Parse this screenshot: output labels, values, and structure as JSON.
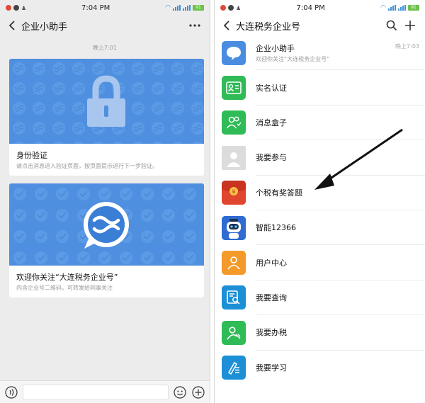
{
  "status_bar": {
    "time": "7:04 PM",
    "battery": "91"
  },
  "left": {
    "title": "企业小助手",
    "timestamp": "晚上7:01",
    "cards": [
      {
        "title": "身份验证",
        "desc": "请点击消息进入验证页面，按页面提示进行下一步验证。"
      },
      {
        "title": "欢迎你关注“大连税务企业号”",
        "desc": "内含企业号二维码，可转发给同事关注"
      }
    ]
  },
  "right": {
    "title": "大连税务企业号",
    "items": [
      {
        "label": "企业小助手",
        "sub": "欢迎你关注“大连税务企业号”",
        "time": "晚上7:03",
        "icon": "chat-bubble-icon",
        "color": "#4a8de0"
      },
      {
        "label": "实名认证",
        "icon": "id-card-icon",
        "color": "#2fbb55"
      },
      {
        "label": "消息盒子",
        "icon": "people-icon",
        "color": "#2fbb55"
      },
      {
        "label": "我要参与",
        "icon": "person-placeholder-icon",
        "color": "#dcdcdc"
      },
      {
        "label": "个税有奖答题",
        "icon": "red-envelope-icon",
        "color": "#e0452f"
      },
      {
        "label": "智能12366",
        "icon": "robot-icon",
        "color": "#2f6bd0"
      },
      {
        "label": "用户中心",
        "icon": "user-center-icon",
        "color": "#f39a2a"
      },
      {
        "label": "我要查询",
        "icon": "search-document-icon",
        "color": "#1d8fd6"
      },
      {
        "label": "我要办税",
        "icon": "handle-tax-icon",
        "color": "#2fbb55"
      },
      {
        "label": "我要学习",
        "icon": "study-icon",
        "color": "#1d8fd6"
      }
    ]
  },
  "colors": {
    "banner_blue": "#4f8fe0",
    "wechat_green": "#2fbb55",
    "arrow": "#111111"
  }
}
